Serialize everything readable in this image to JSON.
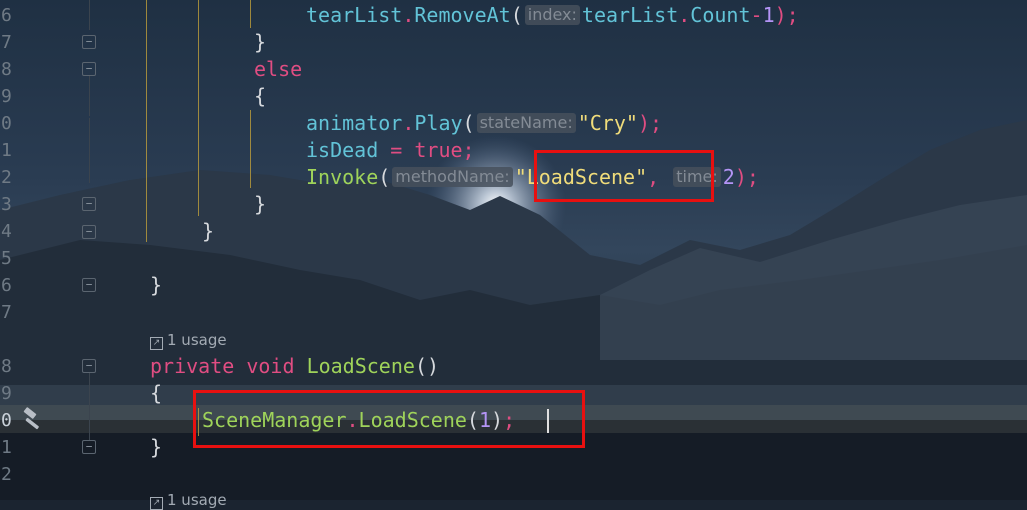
{
  "line_numbers": [
    "6",
    "7",
    "8",
    "9",
    "0",
    "1",
    "2",
    "3",
    "4",
    "5",
    "6",
    "7",
    "8",
    "9",
    "0",
    "1",
    "2"
  ],
  "code": {
    "l_tearlist": {
      "obj": "tearList",
      "dot": ".",
      "method": "RemoveAt",
      "open": "(",
      "hint": "index:",
      "arg_obj": "tearList",
      "dot2": ".",
      "prop": "Count",
      "minus": "-",
      "num": "1",
      "close": ");"
    },
    "l_close1": "}",
    "l_else": "else",
    "l_open1": "{",
    "l_animator": {
      "obj": "animator",
      "dot": ".",
      "method": "Play",
      "open": "(",
      "hint": "stateName:",
      "str": "\"Cry\"",
      "close": ");"
    },
    "l_isdead": {
      "field": "isDead",
      "op": " = ",
      "val": "true",
      "semi": ";"
    },
    "l_invoke": {
      "method": "Invoke",
      "open": "(",
      "hint1": "methodName:",
      "str": "\"LoadScene\"",
      "comma": ",",
      "hint2": "time:",
      "num": "2",
      "close": ");"
    },
    "l_close2": "}",
    "l_close3": "}",
    "l_close4": "}",
    "usage1": "1 usage",
    "l_decl": {
      "kw1": "private",
      "kw2": "void",
      "name": "LoadScene",
      "parens": "()"
    },
    "l_open2": "{",
    "l_scenemgr": {
      "type": "SceneManager",
      "dot": ".",
      "method": "LoadScene",
      "open": "(",
      "num": "1",
      "close": ")",
      "semi": ";"
    },
    "l_close5": "}",
    "usage2": "1 usage"
  },
  "icons": {
    "hammer": "hammer-icon",
    "fold": "fold-toggle-icon",
    "usage": "usage-arrow-icon"
  },
  "colors": {
    "keyword": "#e04d82",
    "method": "#62c3d7",
    "type": "#9fd35a",
    "string": "#f0dc7a",
    "number": "#b494f6",
    "highlight_box": "#e81010",
    "indent_guide": "#c8a63a"
  }
}
